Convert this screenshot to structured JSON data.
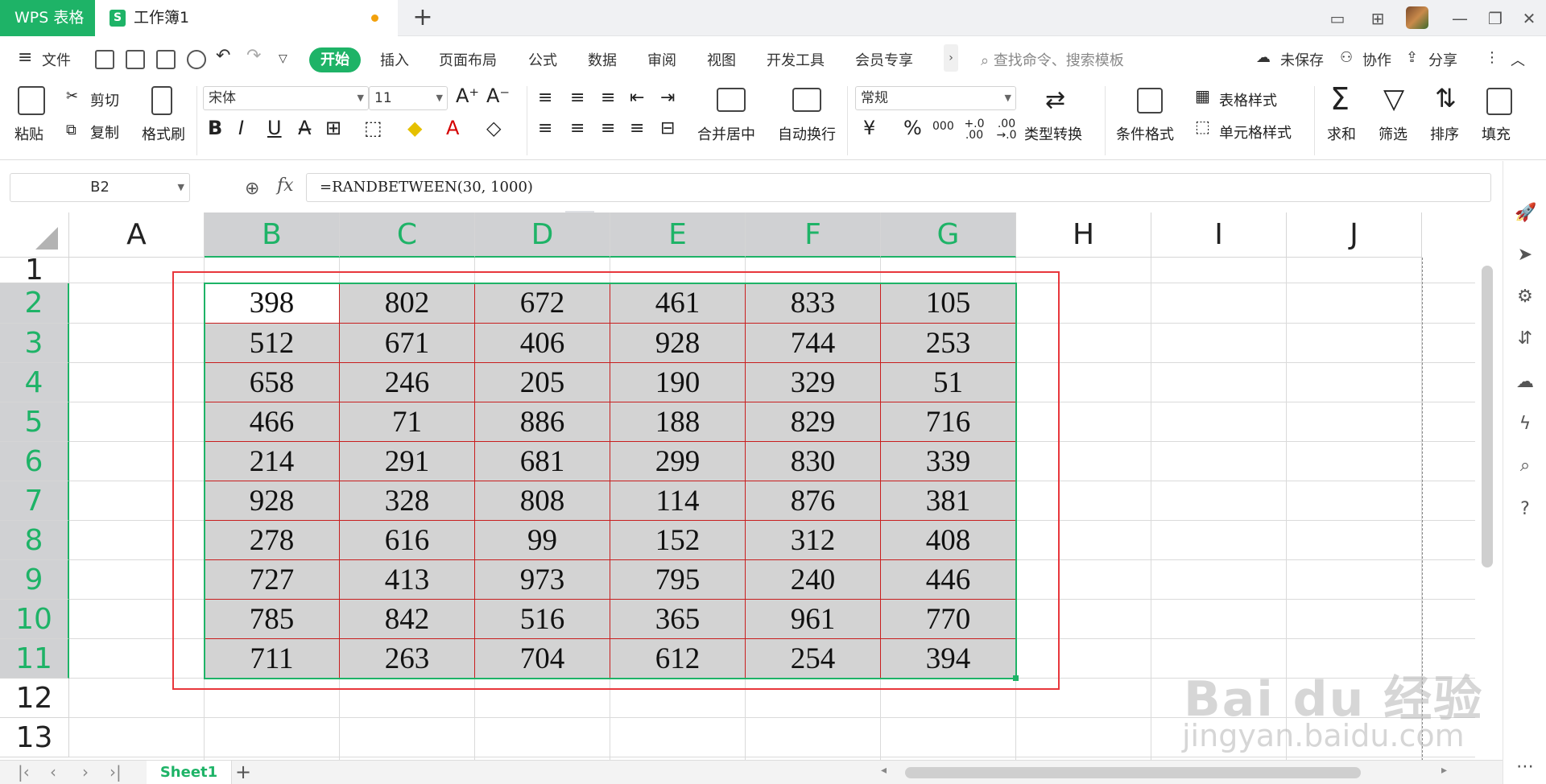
{
  "titlebar": {
    "app_tab": "WPS 表格",
    "doc_tab": "工作簿1",
    "doc_icon": "S",
    "new_tab": "+"
  },
  "menubar": {
    "file": "文件",
    "active_tab": "开始",
    "tabs": [
      "插入",
      "页面布局",
      "公式",
      "数据",
      "审阅",
      "视图",
      "开发工具",
      "会员专享"
    ],
    "search_placeholder": "查找命令、搜索模板",
    "unsaved": "未保存",
    "collab": "协作",
    "share": "分享"
  },
  "ribbon": {
    "paste": "粘贴",
    "cut": "剪切",
    "copy": "复制",
    "format_painter": "格式刷",
    "font_name": "宋体",
    "font_size": "11",
    "merge_center": "合并居中",
    "wrap_text": "自动换行",
    "number_format": "常规",
    "type_convert": "类型转换",
    "conditional_format": "条件格式",
    "table_style": "表格样式",
    "cell_style": "单元格样式",
    "sum": "求和",
    "filter": "筛选",
    "sort": "排序",
    "fill": "填充",
    "currency": "¥",
    "percent": "%",
    "thousands": "000",
    "inc_decimal": "+.0 .00",
    "dec_decimal": ".00 →.0"
  },
  "formula_bar": {
    "cell_ref": "B2",
    "fx": "fx",
    "formula": "=RANDBETWEEN(30, 1000)"
  },
  "sheet": {
    "columns": [
      "A",
      "B",
      "C",
      "D",
      "E",
      "F",
      "G",
      "H",
      "I",
      "J"
    ],
    "rows": [
      "1",
      "2",
      "3",
      "4",
      "5",
      "6",
      "7",
      "8",
      "9",
      "10",
      "11",
      "12",
      "13"
    ],
    "data": [
      [
        "398",
        "802",
        "672",
        "461",
        "833",
        "105"
      ],
      [
        "512",
        "671",
        "406",
        "928",
        "744",
        "253"
      ],
      [
        "658",
        "246",
        "205",
        "190",
        "329",
        "51"
      ],
      [
        "466",
        "71",
        "886",
        "188",
        "829",
        "716"
      ],
      [
        "214",
        "291",
        "681",
        "299",
        "830",
        "339"
      ],
      [
        "928",
        "328",
        "808",
        "114",
        "876",
        "381"
      ],
      [
        "278",
        "616",
        "99",
        "152",
        "312",
        "408"
      ],
      [
        "727",
        "413",
        "973",
        "795",
        "240",
        "446"
      ],
      [
        "785",
        "842",
        "516",
        "365",
        "961",
        "770"
      ],
      [
        "711",
        "263",
        "704",
        "612",
        "254",
        "394"
      ]
    ]
  },
  "bottombar": {
    "sheet_tab": "Sheet1",
    "add_sheet": "+"
  },
  "watermark": {
    "line1": "Bai du 经验",
    "line2": "jingyan.baidu.com"
  },
  "colors": {
    "accent": "#1eb367",
    "cell_fill": "#d3d3d3",
    "cell_border": "#c81e1e",
    "annotation": "#e8373c"
  }
}
